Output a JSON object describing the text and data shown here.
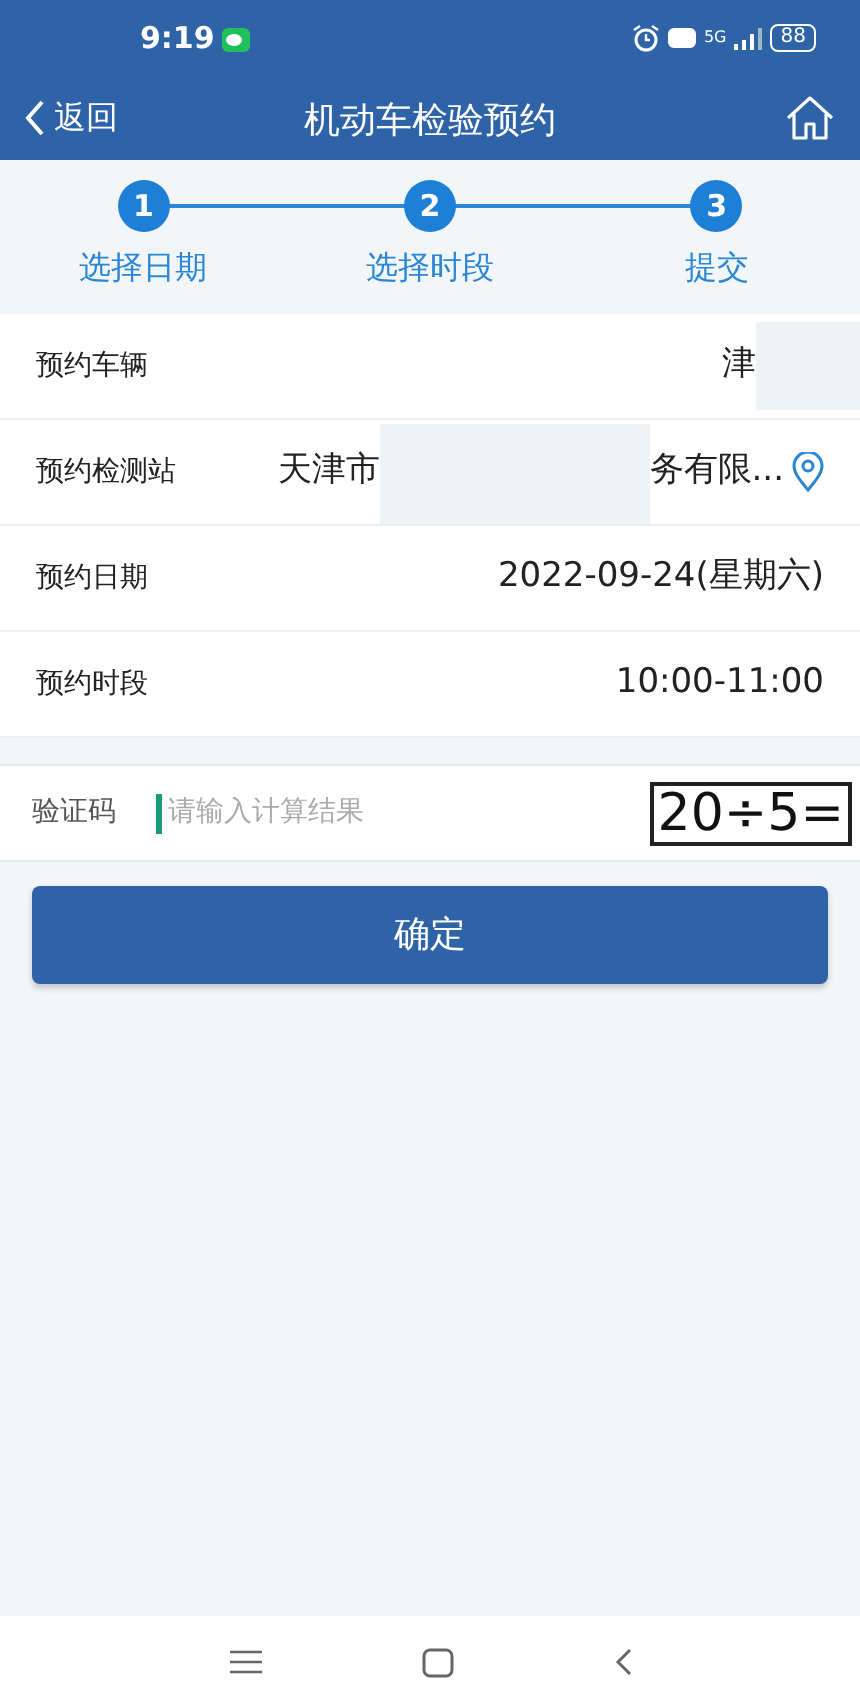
{
  "status_bar": {
    "time": "9:19",
    "battery": "88",
    "network": "5G"
  },
  "header": {
    "back": "返回",
    "title": "机动车检验预约"
  },
  "steps": [
    {
      "number": "1",
      "label": "选择日期"
    },
    {
      "number": "2",
      "label": "选择时段"
    },
    {
      "number": "3",
      "label": "提交"
    }
  ],
  "rows": [
    {
      "label": "预约车辆",
      "value_start": "津",
      "redacted": true
    },
    {
      "label": "预约检测站",
      "value_start": "天津市",
      "redacted": true,
      "value_end": "务有限...",
      "location_icon": true
    },
    {
      "label": "预约日期",
      "value_start": "2022-09-24(星期六)",
      "redacted": false
    },
    {
      "label": "预约时段",
      "value_start": "10:00-11:00",
      "redacted": false
    }
  ],
  "captcha": {
    "label": "验证码",
    "placeholder": "请输入计算结果",
    "challenge": "20÷5="
  },
  "submit": "确定"
}
